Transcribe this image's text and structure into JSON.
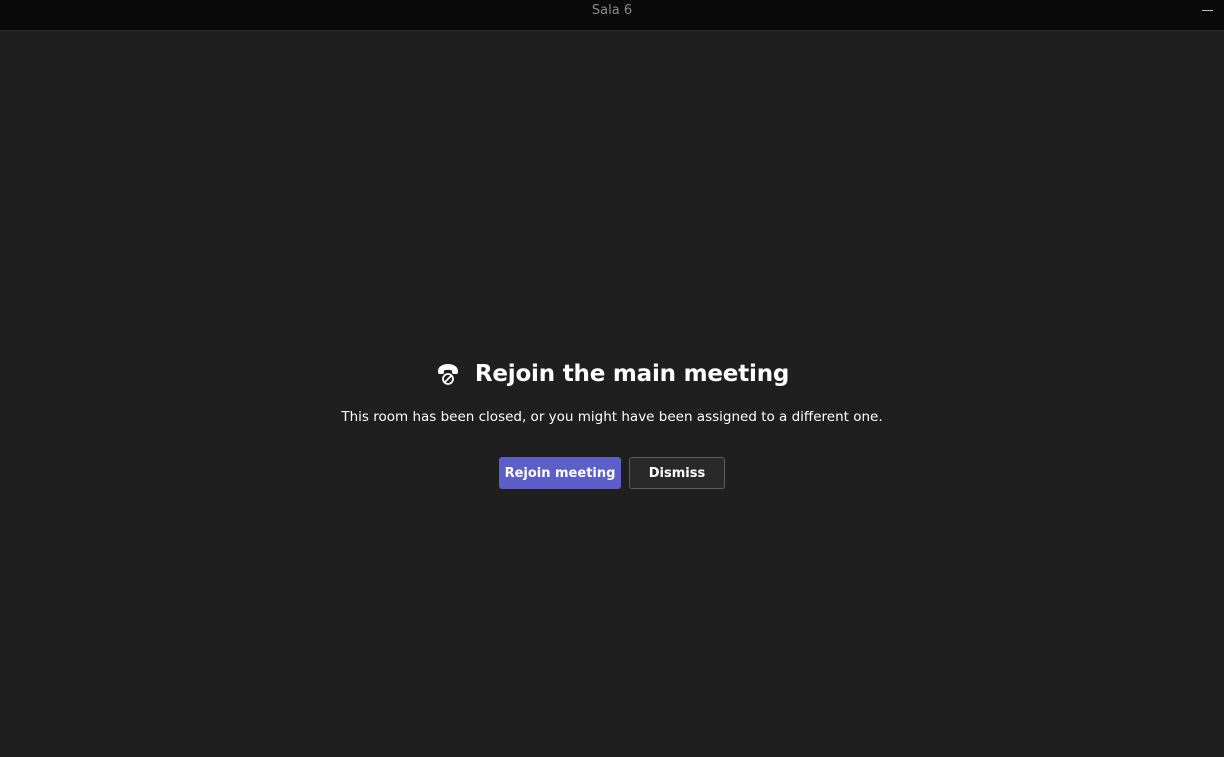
{
  "window": {
    "title": "Sala 6"
  },
  "dialog": {
    "icon": "phone-hangup-icon",
    "heading": "Rejoin the main meeting",
    "message": "This room has been closed, or you might have been assigned to a different one.",
    "rejoin_label": "Rejoin meeting",
    "dismiss_label": "Dismiss"
  },
  "colors": {
    "background": "#1f1f1f",
    "titlebar": "#0a0a0a",
    "accent": "#5b5fc7",
    "secondary_button": "#292929"
  }
}
